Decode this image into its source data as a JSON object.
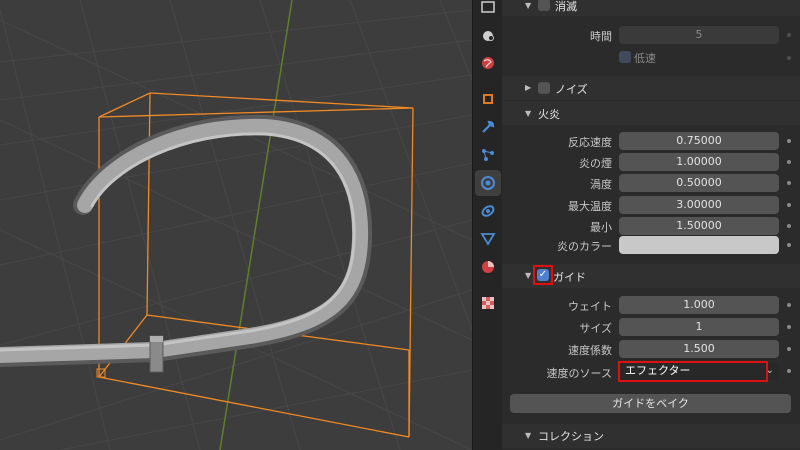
{
  "sections": {
    "dissolve": {
      "title": "消滅"
    },
    "noise": {
      "title": "ノイズ"
    },
    "fire": {
      "title": "火炎"
    },
    "guides": {
      "title": "ガイド",
      "enabled": true
    },
    "collections": {
      "title": "コレクション"
    }
  },
  "dissolve_props": {
    "time_label": "時間",
    "time_value": "5",
    "slow_label": "低速"
  },
  "fire_props": {
    "reaction_speed_label": "反応速度",
    "reaction_speed_value": "0.75000",
    "flame_smoke_label": "炎の煙",
    "flame_smoke_value": "1.00000",
    "vorticity_label": "渦度",
    "vorticity_value": "0.50000",
    "max_temp_label": "最大温度",
    "max_temp_value": "3.00000",
    "min_label": "最小",
    "min_value": "1.50000",
    "flame_color_label": "炎のカラー",
    "flame_color": "#c8c8c8"
  },
  "guide_props": {
    "weight_label": "ウェイト",
    "weight_value": "1.000",
    "size_label": "サイズ",
    "size_value": "1",
    "velocity_factor_label": "速度係数",
    "velocity_factor_value": "1.500",
    "velocity_source_label": "速度のソース",
    "velocity_source_value": "エフェクター",
    "bake_button": "ガイドをベイク"
  },
  "colors": {
    "viewport_bg": "#3d3d3d",
    "selection_orange": "#f08a24",
    "highlight_red": "#e01010",
    "checkbox_blue": "#4f7fd1",
    "pipe_gray": "#a0a0a0"
  },
  "icons": [
    "scene-icon",
    "world-icon",
    "object-icon",
    "modifier-icon",
    "particles-icon",
    "physics-icon",
    "constraint-icon",
    "object-data-icon",
    "material-icon",
    "texture-icon"
  ]
}
